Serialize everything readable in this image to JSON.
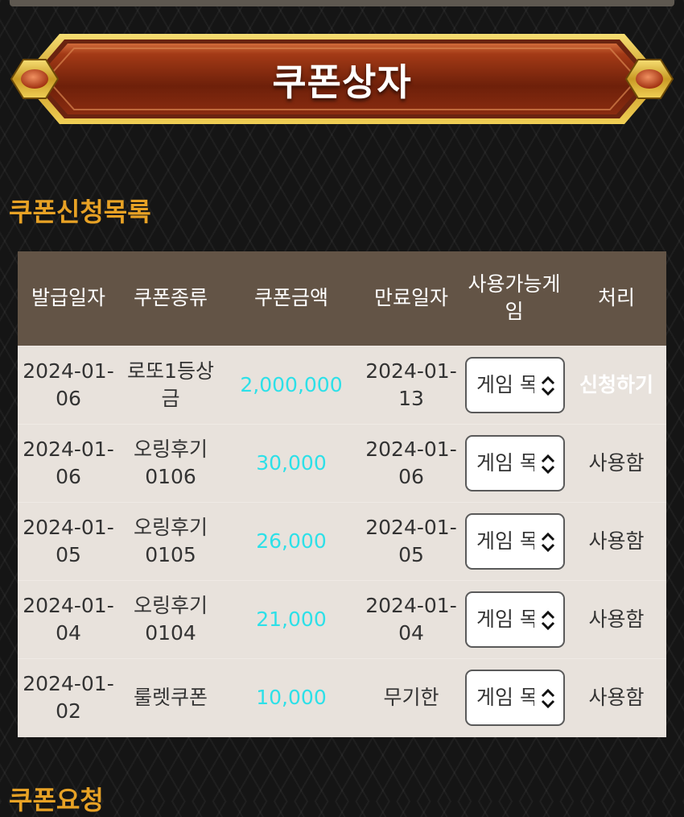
{
  "header": {
    "title": "쿠폰상자"
  },
  "section_list": {
    "title": "쿠폰신청목록"
  },
  "section_recommend": {
    "title": "쿠폰요청"
  },
  "table": {
    "columns": [
      "발급일자",
      "쿠폰종류",
      "쿠폰금액",
      "만료일자",
      "사용가능게임",
      "처리"
    ],
    "rows": [
      {
        "issued": "2024-01-06",
        "type": "로또1등상금",
        "amount": "2,000,000",
        "expires": "2024-01-13",
        "game": "게임 목",
        "action": "신청하기"
      },
      {
        "issued": "2024-01-06",
        "type": "오링후기0106",
        "amount": "30,000",
        "expires": "2024-01-06",
        "game": "게임 목",
        "action": "사용함"
      },
      {
        "issued": "2024-01-05",
        "type": "오링후기0105",
        "amount": "26,000",
        "expires": "2024-01-05",
        "game": "게임 목",
        "action": "사용함"
      },
      {
        "issued": "2024-01-04",
        "type": "오링후기0104",
        "amount": "21,000",
        "expires": "2024-01-04",
        "game": "게임 목",
        "action": "사용함"
      },
      {
        "issued": "2024-01-02",
        "type": "룰렛쿠폰",
        "amount": "10,000",
        "expires": "무기한",
        "game": "게임 목",
        "action": "사용함"
      }
    ]
  },
  "colors": {
    "section_title": "#e8a225",
    "header_bg": "#635446",
    "row_bg": "#e8e2dc",
    "amount": "#2de0e8",
    "banner_red": "#8a2a10",
    "banner_gold": "#d9b43a"
  }
}
